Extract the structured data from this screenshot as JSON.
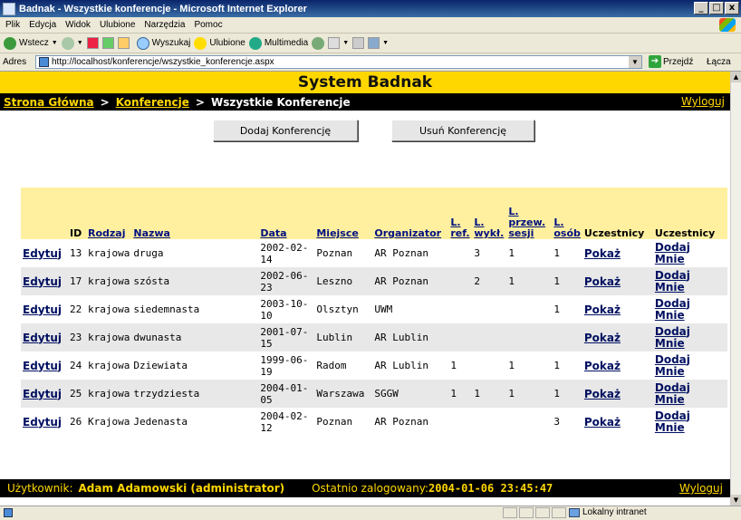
{
  "window": {
    "title": "Badnak - Wszystkie konferencje - Microsoft Internet Explorer",
    "min": "_",
    "max": "□",
    "close": "x"
  },
  "menu": [
    "Plik",
    "Edycja",
    "Widok",
    "Ulubione",
    "Narzędzia",
    "Pomoc"
  ],
  "toolbar": {
    "back": "Wstecz",
    "search": "Wyszukaj",
    "favorites": "Ulubione",
    "multimedia": "Multimedia"
  },
  "address": {
    "label": "Adres",
    "url": "http://localhost/konferencje/wszystkie_konferencje.aspx",
    "go": "Przejdź",
    "links": "Łącza"
  },
  "app": {
    "title": "System Badnak",
    "breadcrumb": {
      "home": "Strona Główna",
      "sep1": ">",
      "conf": "Konferencje",
      "sep2": ">",
      "current": "Wszystkie Konferencje"
    },
    "logout": "Wyloguj",
    "add_button": "Dodaj Konferencję",
    "remove_button": "Usuń Konferencję",
    "columns": [
      "",
      "ID",
      "Rodzaj",
      "Nazwa",
      "Data",
      "Miejsce",
      "Organizator",
      "L. ref.",
      "L. wykł.",
      "L. przew. sesji",
      "L. osób",
      "Uczestnicy",
      "Uczestnicy"
    ],
    "edit_label": "Edytuj",
    "show_label": "Pokaż",
    "join_label": "Dodaj Mnie",
    "rows": [
      {
        "id": "13",
        "type": "krajowa",
        "name": "druga",
        "date": "2002-02-14",
        "place": "Poznan",
        "org": "AR Poznan",
        "ref": "",
        "wykl": "3",
        "przew": "1",
        "osob": "1",
        "show": true
      },
      {
        "id": "17",
        "type": "krajowa",
        "name": "szósta",
        "date": "2002-06-23",
        "place": "Leszno",
        "org": "AR Poznan",
        "ref": "",
        "wykl": "2",
        "przew": "1",
        "osob": "1",
        "show": true
      },
      {
        "id": "22",
        "type": "krajowa",
        "name": "siedemnasta",
        "date": "2003-10-10",
        "place": "Olsztyn",
        "org": "UWM",
        "ref": "",
        "wykl": "",
        "przew": "",
        "osob": "1",
        "show": true
      },
      {
        "id": "23",
        "type": "krajowa",
        "name": "dwunasta",
        "date": "2001-07-15",
        "place": "Lublin",
        "org": "AR Lublin",
        "ref": "",
        "wykl": "",
        "przew": "",
        "osob": "",
        "show": true
      },
      {
        "id": "24",
        "type": "krajowa",
        "name": "Dziewiata",
        "date": "1999-06-19",
        "place": "Radom",
        "org": "AR Lublin",
        "ref": "1",
        "wykl": "",
        "przew": "1",
        "osob": "1",
        "show": true
      },
      {
        "id": "25",
        "type": "krajowa",
        "name": "trzydziesta",
        "date": "2004-01-05",
        "place": "Warszawa",
        "org": "SGGW",
        "ref": "1",
        "wykl": "1",
        "przew": "1",
        "osob": "1",
        "show": true
      },
      {
        "id": "26",
        "type": "Krajowa",
        "name": "Jedenasta",
        "date": "2004-02-12",
        "place": "Poznan",
        "org": "AR Poznan",
        "ref": "",
        "wykl": "",
        "przew": "",
        "osob": "3",
        "show": true
      }
    ],
    "footer": {
      "user_label": "Użytkownik:",
      "user": "Adam Adamowski (administrator)",
      "last_label": "Ostatnio zalogowany:",
      "last": "2004-01-06 23:45:47",
      "logout": "Wyloguj"
    }
  },
  "status": {
    "zone": "Lokalny intranet"
  }
}
